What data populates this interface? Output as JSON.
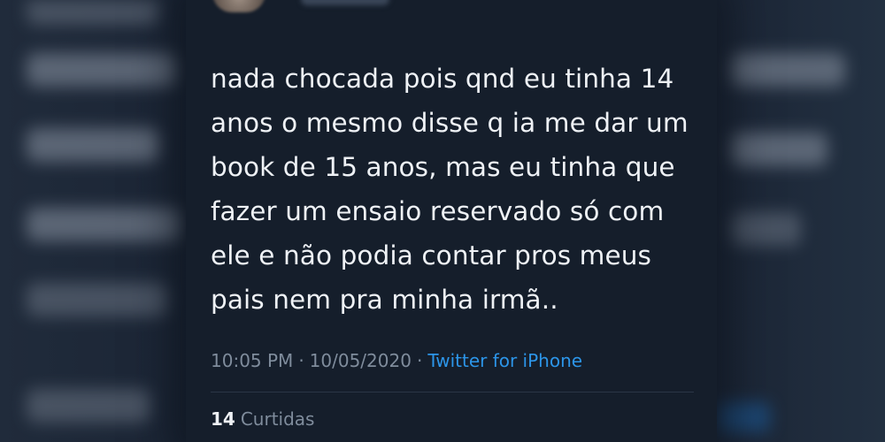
{
  "tweet": {
    "text": "nada chocada pois qnd eu tinha 14\nanos o mesmo disse q ia me dar um\nbook de 15 anos, mas eu tinha que\nfazer um ensaio reservado só com\nele e não podia contar pros meus\npais nem pra minha irmã..",
    "time": "10:05 PM",
    "separator": "·",
    "date": "10/05/2020",
    "source": "Twitter for iPhone",
    "likes_count": "14",
    "likes_label": "Curtidas"
  },
  "colors": {
    "background": "#151e2b",
    "text": "#eef1f5",
    "meta": "#7f8c9c",
    "accent": "#2c95e8"
  }
}
